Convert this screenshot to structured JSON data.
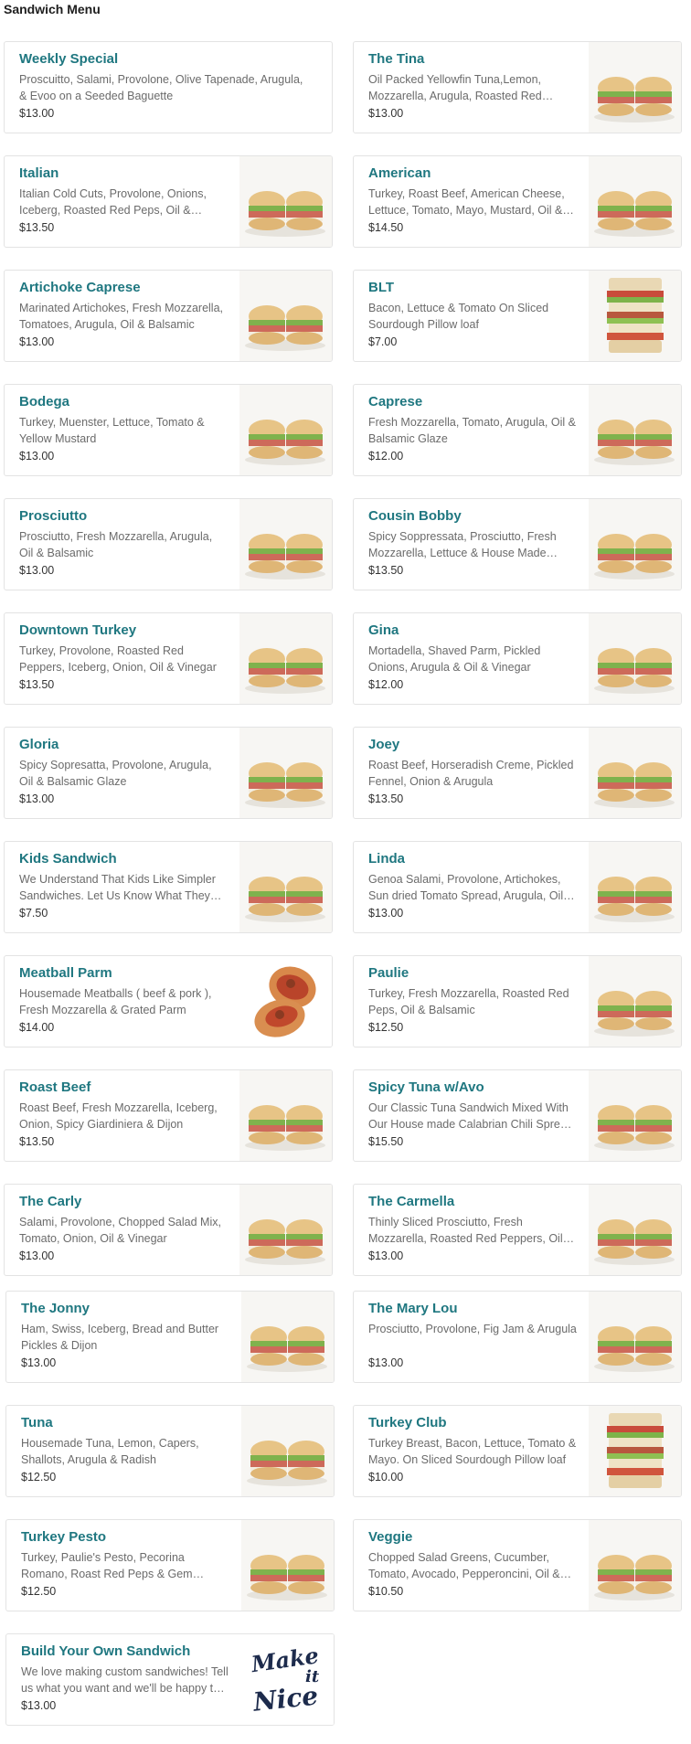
{
  "page": {
    "title": "Sandwich Menu"
  },
  "items": [
    {
      "name": "Weekly Special",
      "desc": "Proscuitto, Salami, Provolone, Olive Tapenade, Arugula, & Evoo on a Seeded Baguette",
      "price": "$13.00",
      "image": "none"
    },
    {
      "name": "The Tina",
      "desc": "Oil Packed Yellowfin Tuna,Lemon, Mozzarella, Arugula, Roasted Red Peppers, Oil & Balsamic",
      "price": "$13.00",
      "image": "sandwich-photo"
    },
    {
      "name": "Italian",
      "desc": "Italian Cold Cuts, Provolone, Onions, Iceberg, Roasted Red Peps, Oil & Vinegar",
      "price": "$13.50",
      "image": "sandwich-photo"
    },
    {
      "name": "American",
      "desc": "Turkey, Roast Beef, American Cheese, Lettuce, Tomato, Mayo, Mustard, Oil & Vinegar",
      "price": "$14.50",
      "image": "sandwich-photo"
    },
    {
      "name": "Artichoke Caprese",
      "desc": "Marinated Artichokes, Fresh Mozzarella, Tomatoes, Arugula, Oil & Balsamic",
      "price": "$13.00",
      "image": "sandwich-photo"
    },
    {
      "name": "BLT",
      "desc": "Bacon, Lettuce & Tomato On Sliced Sourdough Pillow loaf",
      "price": "$7.00",
      "image": "club-sandwich-photo"
    },
    {
      "name": "Bodega",
      "desc": "Turkey, Muenster, Lettuce, Tomato & Yellow Mustard",
      "price": "$13.00",
      "image": "sandwich-photo"
    },
    {
      "name": "Caprese",
      "desc": "Fresh Mozzarella, Tomato, Arugula, Oil & Balsamic Glaze",
      "price": "$12.00",
      "image": "sandwich-photo"
    },
    {
      "name": "Prosciutto",
      "desc": "Prosciutto, Fresh Mozzarella, Arugula, Oil & Balsamic",
      "price": "$13.00",
      "image": "sandwich-photo"
    },
    {
      "name": "Cousin Bobby",
      "desc": "Spicy Soppressata, Prosciutto, Fresh Mozzarella, Lettuce & House Made Pesto",
      "price": "$13.50",
      "image": "sandwich-photo"
    },
    {
      "name": "Downtown Turkey",
      "desc": "Turkey, Provolone, Roasted Red Peppers, Iceberg, Onion, Oil & Vinegar",
      "price": "$13.50",
      "image": "sandwich-photo"
    },
    {
      "name": "Gina",
      "desc": "Mortadella, Shaved Parm, Pickled Onions, Arugula & Oil & Vinegar",
      "price": "$12.00",
      "image": "sandwich-photo"
    },
    {
      "name": "Gloria",
      "desc": "Spicy Sopresatta, Provolone, Arugula, Oil & Balsamic Glaze",
      "price": "$13.00",
      "image": "sandwich-photo"
    },
    {
      "name": "Joey",
      "desc": "Roast Beef, Horseradish Creme, Pickled Fennel, Onion & Arugula",
      "price": "$13.50",
      "image": "sandwich-photo"
    },
    {
      "name": "Kids Sandwich",
      "desc": "We Understand That Kids Like Simpler Sandwiches. Let Us Know What They Like",
      "price": "$7.50",
      "image": "sandwich-photo"
    },
    {
      "name": "Linda",
      "desc": "Genoa Salami, Provolone, Artichokes, Sun dried Tomato Spread, Arugula, Oil & Balsamic",
      "price": "$13.00",
      "image": "sandwich-photo"
    },
    {
      "name": "Meatball Parm",
      "desc": "Housemade Meatballs ( beef & pork ), Fresh Mozzarella & Grated Parm",
      "price": "$14.00",
      "image": "meatball-photo"
    },
    {
      "name": "Paulie",
      "desc": "Turkey, Fresh Mozzarella, Roasted Red Peps, Oil & Balsamic",
      "price": "$12.50",
      "image": "sandwich-photo"
    },
    {
      "name": "Roast Beef",
      "desc": "Roast Beef, Fresh Mozzarella, Iceberg, Onion, Spicy Giardiniera & Dijon",
      "price": "$13.50",
      "image": "sandwich-photo"
    },
    {
      "name": "Spicy Tuna w/Avo",
      "desc": "Our Classic Tuna Sandwich Mixed With Our House made Calabrian Chili Spread & Avocado",
      "price": "$15.50",
      "image": "sandwich-photo"
    },
    {
      "name": "The Carly",
      "desc": "Salami, Provolone, Chopped Salad Mix, Tomato, Onion, Oil & Vinegar",
      "price": "$13.00",
      "image": "sandwich-photo"
    },
    {
      "name": "The Carmella",
      "desc": "Thinly Sliced Prosciutto, Fresh Mozzarella, Roasted Red Peppers, Oil & Balsamic",
      "price": "$13.00",
      "image": "sandwich-photo"
    },
    {
      "name": "The Jonny",
      "desc": "Ham, Swiss, Iceberg, Bread and Butter Pickles & Dijon",
      "price": "$13.00",
      "image": "sandwich-photo"
    },
    {
      "name": "The Mary Lou",
      "desc": "Prosciutto, Provolone, Fig Jam & Arugula",
      "price": "$13.00",
      "image": "sandwich-photo"
    },
    {
      "name": "Tuna",
      "desc": "Housemade Tuna, Lemon, Capers, Shallots, Arugula & Radish",
      "price": "$12.50",
      "image": "sandwich-photo"
    },
    {
      "name": "Turkey Club",
      "desc": "Turkey Breast, Bacon, Lettuce, Tomato & Mayo. On Sliced Sourdough Pillow loaf",
      "price": "$10.00",
      "image": "club-sandwich-photo"
    },
    {
      "name": "Turkey Pesto",
      "desc": "Turkey, Paulie's Pesto, Pecorina Romano, Roast Red Peps & Gem Lettuce",
      "price": "$12.50",
      "image": "sandwich-photo"
    },
    {
      "name": "Veggie",
      "desc": "Chopped Salad Greens, Cucumber, Tomato, Avocado, Pepperoncini, Oil & Vinegar",
      "price": "$10.50",
      "image": "sandwich-photo"
    },
    {
      "name": "Build Your Own Sandwich",
      "desc": "We love making custom sandwiches! Tell us what you want and we'll be happy to make it",
      "price": "$13.00",
      "image": "logo",
      "logo_text_1": "Make",
      "logo_text_2": "it",
      "logo_text_3": "Nice"
    }
  ],
  "colors": {
    "item_name": "#1f7780",
    "description": "#6b6b6b",
    "card_border": "#e3e3e3"
  }
}
